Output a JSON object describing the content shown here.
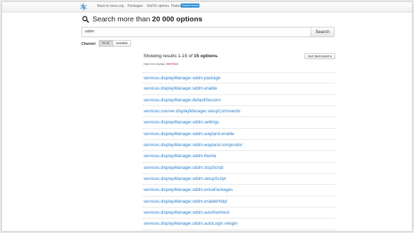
{
  "navbar": {
    "items": [
      {
        "label": "Back to nixos.org"
      },
      {
        "label": "Packages"
      },
      {
        "label": "NixOS options"
      },
      {
        "label": "Flakes"
      }
    ],
    "badge": "Experimental",
    "colors": {
      "badge": "#2a8fd6"
    }
  },
  "heading": {
    "prefix": "Search more than",
    "count": "20 000 options"
  },
  "search": {
    "value": "sddm",
    "button": "Search"
  },
  "channel": {
    "label": "Channel:",
    "options": [
      {
        "label": "24.11",
        "active": true
      },
      {
        "label": "unstable",
        "active": false
      }
    ]
  },
  "results": {
    "showing_prefix": "Showing results 1-15 of",
    "total": "15 options",
    "suffix": ".",
    "data_from": "Data from nixpkgs",
    "commit": "60dff84e",
    "sort_label": "Sort: Best match",
    "items": [
      {
        "name": "services.displayManager.sddm.package"
      },
      {
        "name": "services.displayManager.sddm.enable"
      },
      {
        "name": "services.displayManager.defaultSession"
      },
      {
        "name": "services.xserver.displayManager.setupCommands"
      },
      {
        "name": "services.displayManager.sddm.settings"
      },
      {
        "name": "services.displayManager.sddm.wayland.enable"
      },
      {
        "name": "services.displayManager.sddm.wayland.compositor"
      },
      {
        "name": "services.displayManager.sddm.theme"
      },
      {
        "name": "services.displayManager.sddm.stopScript"
      },
      {
        "name": "services.displayManager.sddm.setupScript"
      },
      {
        "name": "services.displayManager.sddm.extraPackages"
      },
      {
        "name": "services.displayManager.sddm.enableHidpi"
      },
      {
        "name": "services.displayManager.sddm.autoNumlock"
      },
      {
        "name": "services.displayManager.sddm.autoLogin.relogin"
      }
    ]
  }
}
